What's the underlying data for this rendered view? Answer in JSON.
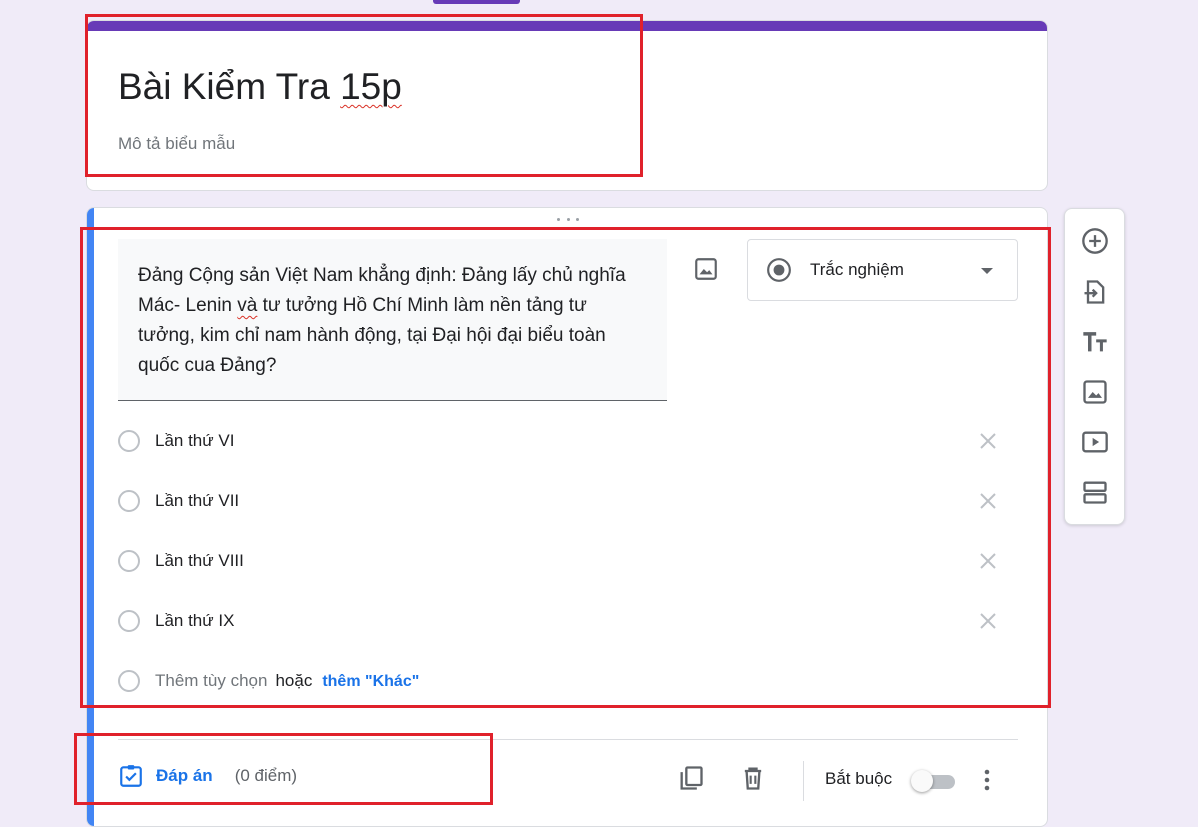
{
  "form": {
    "title_main": "Bài Kiểm Tra ",
    "title_spell": "15p",
    "description_placeholder": "Mô tả biểu mẫu"
  },
  "question": {
    "text_part1": "Đảng Cộng sản Việt Nam khẳng định: Đảng lấy chủ nghĩa Mác- Lenin ",
    "text_spell": "và",
    "text_part2": " tư tưởng Hồ Chí Minh làm nền tảng tư tưởng, kim chỉ nam hành động, tại Đại hội đại biểu toàn quốc cua Đảng?",
    "type_label": "Trắc nghiệm",
    "options": [
      {
        "label": "Lần thứ VI"
      },
      {
        "label": "Lần thứ VII"
      },
      {
        "label": "Lần thứ VIII"
      },
      {
        "label": "Lần thứ IX"
      }
    ],
    "add_option_label": "Thêm tùy chọn",
    "or_label": "hoặc",
    "add_other_label": "thêm \"Khác\""
  },
  "footer": {
    "answer_key_label": "Đáp án",
    "points_label": "(0 điểm)",
    "required_label": "Bắt buộc",
    "required_on": false
  },
  "toolbar": {
    "items": [
      "add-question-icon",
      "import-questions-icon",
      "add-title-icon",
      "add-image-icon",
      "add-video-icon",
      "add-section-icon"
    ]
  },
  "colors": {
    "brand": "#673ab7",
    "active_bar": "#4285f4",
    "link": "#1a73e8",
    "highlight_box": "#e0212b"
  }
}
